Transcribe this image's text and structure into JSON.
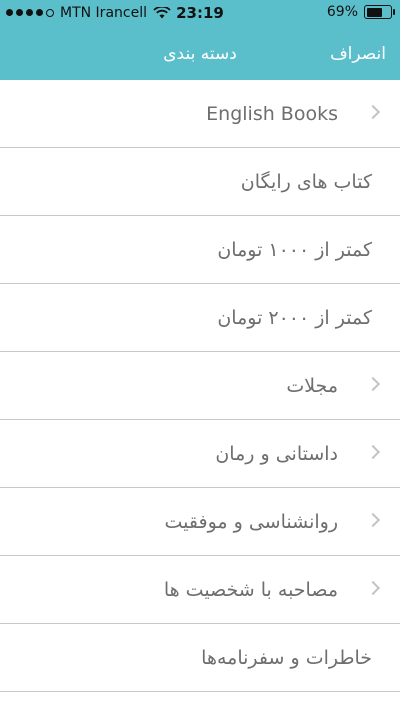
{
  "status_bar": {
    "carrier": "MTN Irancell",
    "time": "23:19",
    "battery_percent_label": "69%",
    "battery_level": 0.69
  },
  "nav": {
    "title": "دسته بندی",
    "cancel_label": "انصراف"
  },
  "colors": {
    "header": "#5bbfcb",
    "row_text": "#6e6e6e",
    "divider": "#c8c8c8",
    "chevron": "#c4c4c4"
  },
  "categories": [
    {
      "label": "English Books",
      "has_chevron": true,
      "icon": "chevron-right-icon"
    },
    {
      "label": "کتاب های رایگان",
      "has_chevron": false
    },
    {
      "label": "کمتر از ۱۰۰۰ تومان",
      "has_chevron": false
    },
    {
      "label": "کمتر از ۲۰۰۰ تومان",
      "has_chevron": false
    },
    {
      "label": "مجلات",
      "has_chevron": true,
      "icon": "chevron-right-icon"
    },
    {
      "label": "داستانی و رمان",
      "has_chevron": true,
      "icon": "chevron-right-icon"
    },
    {
      "label": "روانشناسی و موفقیت",
      "has_chevron": true,
      "icon": "chevron-right-icon"
    },
    {
      "label": "مصاحبه با شخصیت ها",
      "has_chevron": true,
      "icon": "chevron-right-icon"
    },
    {
      "label": "خاطرات و سفرنامه‌ها",
      "has_chevron": false
    }
  ]
}
